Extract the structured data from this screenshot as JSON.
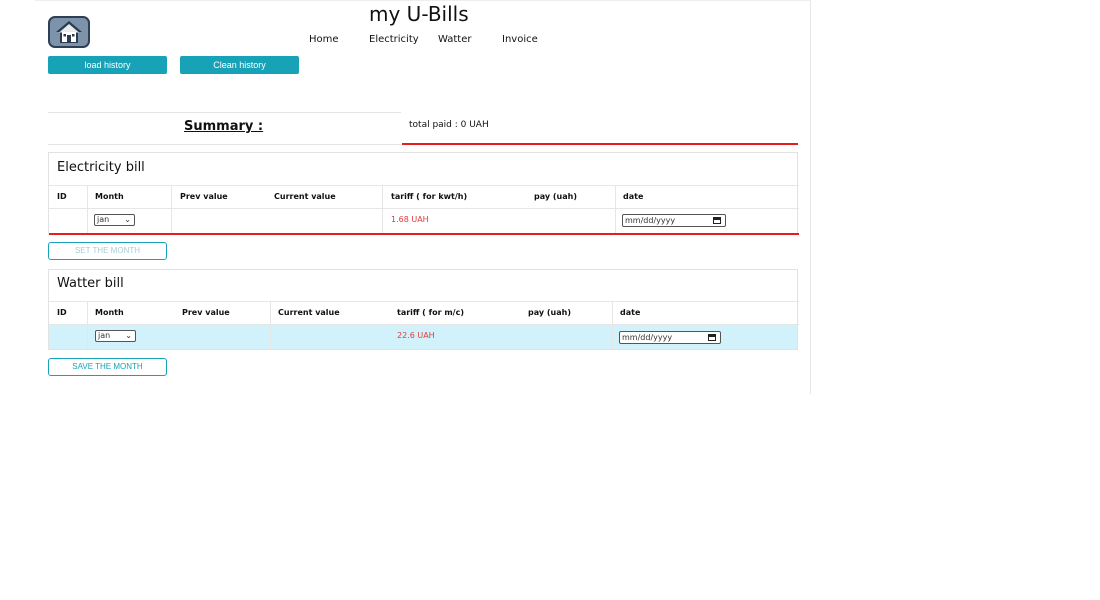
{
  "app": {
    "title": "my U-Bills",
    "nav": [
      "Home",
      "Electricity",
      "Watter",
      "Invoice"
    ],
    "load_history": "load history",
    "clean_history": "Clean history"
  },
  "summary": {
    "title": "Summary :",
    "total_paid": "total paid : 0 UAH"
  },
  "electricity": {
    "title": "Electricity bill",
    "columns": [
      "ID",
      "Month",
      "Prev value",
      "Current value",
      "tariff ( for kwt/h)",
      "pay (uah)",
      "date"
    ],
    "month_value": "jan",
    "tariff_value": "1.68 UAH",
    "date_placeholder": "mm/dd/yyyy",
    "save_button": "SET THE MONTH"
  },
  "water": {
    "title": "Watter bill",
    "columns": [
      "ID",
      "Month",
      "Prev value",
      "Current value",
      "tariff ( for m/c)",
      "pay (uah)",
      "date"
    ],
    "month_value": "jan",
    "tariff_value": "22.6 UAH",
    "date_placeholder": "mm/dd/yyyy",
    "save_button": "SAVE THE MONTH"
  },
  "colors": {
    "accent": "#17a2b8",
    "underline_red": "#e81c1c",
    "tariff_red": "#e03b3b",
    "row_highlight": "#d1f2fb"
  },
  "icons": {
    "home": "house-icon",
    "select": "chevron-down-icon",
    "date": "calendar-icon"
  }
}
